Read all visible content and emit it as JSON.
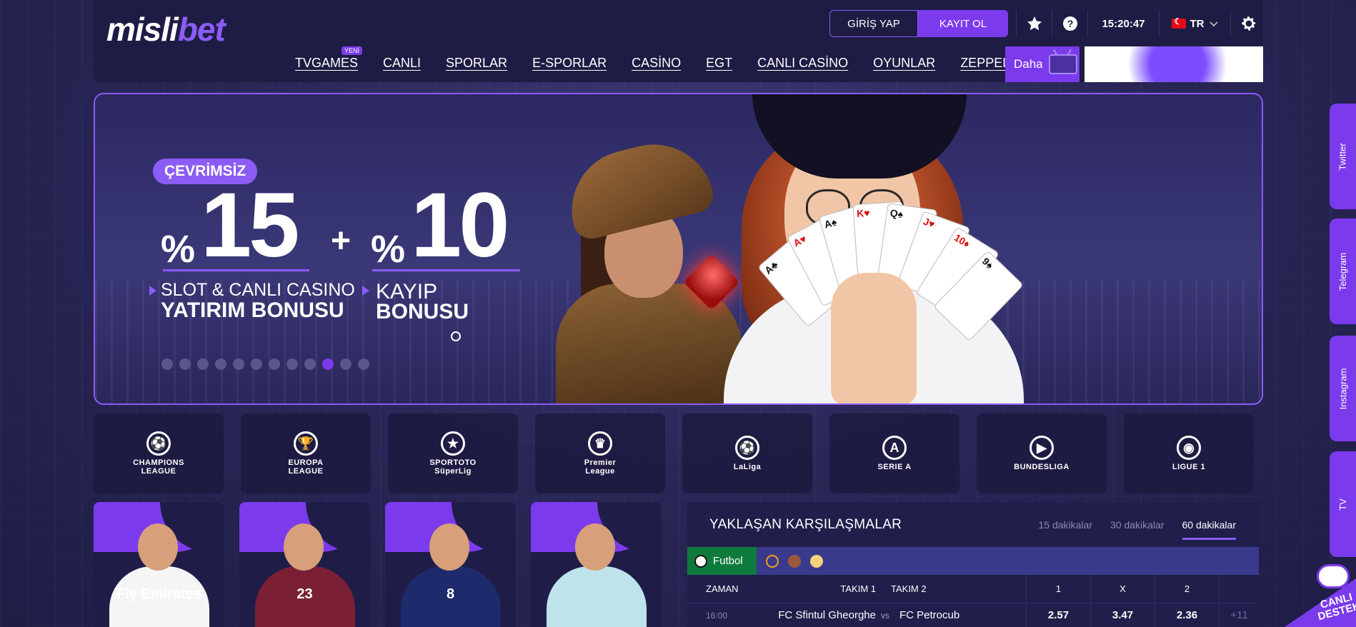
{
  "brand": {
    "logo_part1": "misli",
    "logo_part2": "bet"
  },
  "header": {
    "login_label": "GİRİŞ YAP",
    "register_label": "KAYIT OL",
    "clock": "15:20:47",
    "language": "TR",
    "icons": [
      "star-icon",
      "help-icon",
      "chevron-down-icon",
      "gear-icon"
    ]
  },
  "nav": {
    "items": [
      "TVGAMES",
      "CANLI",
      "SPORLAR",
      "E-SPORLAR",
      "CASİNO",
      "EGT",
      "CANLI CASİNO",
      "OYUNLAR",
      "ZEPPELİN"
    ],
    "new_badge": "YENİ",
    "more_label": "Daha"
  },
  "banner": {
    "tag": "ÇEVRİMSİZ",
    "percent_symbol": "%",
    "left_value": "15",
    "right_value": "10",
    "plus": "+",
    "left_sub_line1": "SLOT & CANLI CASINO",
    "left_sub_line2": "YATIRIM BONUSU",
    "right_sub_line1": "KAYIP",
    "right_sub_line2": "BONUSU",
    "slide_count": 12,
    "active_slide": 9
  },
  "leagues": [
    {
      "icon": "⚽",
      "name_line1": "CHAMPIONS",
      "name_line2": "LEAGUE"
    },
    {
      "icon": "🏆",
      "name_line1": "EUROPA",
      "name_line2": "LEAGUE"
    },
    {
      "icon": "★",
      "name_line1": "SPORTOTO",
      "name_line2": "SüperLig"
    },
    {
      "icon": "♛",
      "name_line1": "Premier",
      "name_line2": "League"
    },
    {
      "icon": "⚽",
      "name_line1": "LaLiga",
      "name_line2": ""
    },
    {
      "icon": "A",
      "name_line1": "SERIE A",
      "name_line2": ""
    },
    {
      "icon": "▶",
      "name_line1": "BUNDESLIGA",
      "name_line2": ""
    },
    {
      "icon": "◉",
      "name_line1": "LIGUE 1",
      "name_line2": ""
    }
  ],
  "players": [
    {
      "jersey": "Fly Emirates",
      "color": "#f5f5f5"
    },
    {
      "jersey": "23",
      "color": "#7a1f34"
    },
    {
      "jersey": "8",
      "color": "#1d2a6b"
    },
    {
      "jersey": "",
      "color": "#bfe3ea"
    }
  ],
  "upcoming": {
    "title": "YAKLAŞAN KARŞILAŞMALAR",
    "tabs": [
      "15 dakikalar",
      "30 dakikalar",
      "60 dakikalar"
    ],
    "active_tab": 2,
    "active_sport": "Futbol",
    "columns": {
      "time": "ZAMAN",
      "team1": "TAKIM 1",
      "team2": "TAKIM 2",
      "o1": "1",
      "ox": "X",
      "o2": "2"
    },
    "rows": [
      {
        "time": "16:00",
        "team1": "FC Sfintul Gheorghe",
        "vs": "vs",
        "team2": "FC Petrocub",
        "o1": "2.57",
        "ox": "3.47",
        "o2": "2.36",
        "more": "+11"
      }
    ]
  },
  "social": [
    "Twitter",
    "Telegram",
    "Instagram",
    "TV"
  ],
  "support": {
    "line1": "CANLI",
    "line2": "DESTEK"
  }
}
